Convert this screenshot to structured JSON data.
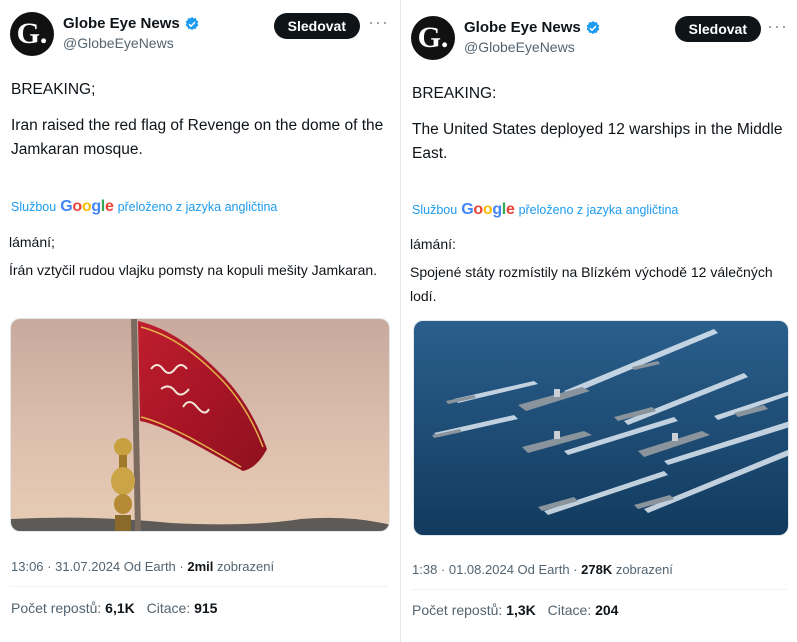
{
  "tweets": [
    {
      "author": {
        "name": "Globe Eye News",
        "handle": "@GlobeEyeNews",
        "avatar_letter": "G."
      },
      "follow_label": "Sledovat",
      "more_label": "···",
      "text_line1": "BREAKING;",
      "text_line2": "Iran raised the red flag of Revenge on the dome of the Jamkaran mosque.",
      "translate_prefix": "Službou",
      "translate_suffix": "přeloženo z jazyka angličtina",
      "translated_line1": "lámání;",
      "translated_line2": "Írán vztyčil rudou vlajku pomsty na kopuli mešity Jamkaran.",
      "image_alt": "red flag over dome",
      "time": "13:06 · 31.07.2024 Od Earth ·",
      "views": "2mil",
      "views_label": "zobrazení",
      "reposts_label": "Počet repostů:",
      "reposts": "6,1K",
      "quotes_label": "Citace:",
      "quotes": "915"
    },
    {
      "author": {
        "name": "Globe Eye News",
        "handle": "@GlobeEyeNews",
        "avatar_letter": "G."
      },
      "follow_label": "Sledovat",
      "more_label": "···",
      "text_line1": "BREAKING:",
      "text_line2": "The United States deployed 12 warships in the Middle East.",
      "translate_prefix": "Službou",
      "translate_suffix": "přeloženo z jazyka angličtina",
      "translated_line1": "lámání:",
      "translated_line2": "Spojené státy rozmístily na Blízkém východě 12 válečných lodí.",
      "image_alt": "warships fleet at sea",
      "time": "1:38 · 01.08.2024 Od Earth ·",
      "views": "278K",
      "views_label": "zobrazení",
      "reposts_label": "Počet repostů:",
      "reposts": "1,3K",
      "quotes_label": "Citace:",
      "quotes": "204"
    }
  ],
  "google_word": [
    "G",
    "o",
    "o",
    "g",
    "l",
    "e"
  ],
  "colors": {
    "verified": "#1d9bf0",
    "link": "#1d9bf0",
    "follow_bg": "#0f1419",
    "flag_red": "#b3182a",
    "sea": "#1c4f7a"
  }
}
